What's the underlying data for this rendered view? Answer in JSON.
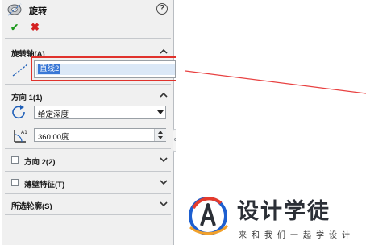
{
  "panel": {
    "title": "旋转",
    "help_glyph": "?",
    "ok_glyph": "✔",
    "cancel_glyph": "✖"
  },
  "sections": {
    "revolve_axis": {
      "label": "旋转轴(A)",
      "value": "直线2"
    },
    "direction1": {
      "label": "方向 1(1)",
      "end_condition": "给定深度",
      "angle": "360.00度"
    },
    "direction2": {
      "label": "方向 2(2)",
      "checked": false
    },
    "thin_feature": {
      "label": "薄壁特征(T)",
      "checked": false
    },
    "selected_contours": {
      "label": "所选轮廓(S)"
    }
  },
  "watermark": {
    "name": "设计学徒",
    "slogan": "来和我们一起学设计"
  },
  "colors": {
    "highlight_box": "#e0322c",
    "selected_text_bg": "#3a78d6",
    "sketch_line": "#e84040",
    "ok": "#1e9a1e",
    "cancel": "#d42020"
  },
  "icons": [
    "revolve-icon",
    "help-icon",
    "ok-icon",
    "cancel-icon",
    "collapse-chevron-icon",
    "axis-line-icon",
    "reverse-direction-icon",
    "angle-icon",
    "expand-chevron-icon",
    "grip-icon"
  ]
}
